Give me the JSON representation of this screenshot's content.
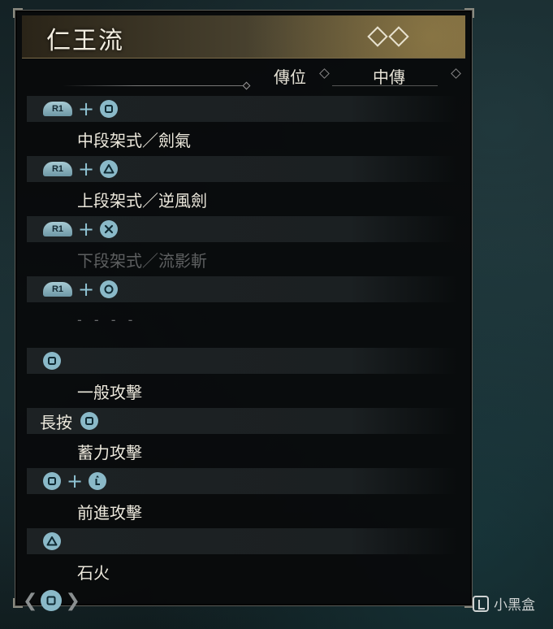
{
  "header": {
    "title": "仁王流"
  },
  "rank": {
    "label": "傳位",
    "value": "中傳"
  },
  "combos": [
    {
      "trigger": "R1",
      "plus": "+",
      "face": "square",
      "action": "中段架式／劍氣",
      "state": "normal"
    },
    {
      "trigger": "R1",
      "plus": "+",
      "face": "triangle",
      "action": "上段架式／逆風劍",
      "state": "normal"
    },
    {
      "trigger": "R1",
      "plus": "+",
      "face": "cross",
      "action": "下段架式／流影斬",
      "state": "disabled"
    },
    {
      "trigger": "R1",
      "plus": "+",
      "face": "circle",
      "action": "- - - -",
      "state": "placeholder"
    }
  ],
  "basics": [
    {
      "prefix": "",
      "face": "square",
      "action": "一般攻擊"
    },
    {
      "prefix": "長按",
      "face": "square",
      "action": "蓄力攻擊"
    },
    {
      "prefix": "",
      "face": "square",
      "extra": "left-stick",
      "plus": "+",
      "action": "前進攻擊"
    },
    {
      "prefix": "",
      "face": "triangle",
      "action": "石火"
    }
  ],
  "footer": {
    "button": "square"
  },
  "watermark": {
    "text": "小黑盒"
  },
  "colors": {
    "accent": "#8ab9c8",
    "text": "#ece8dc",
    "disabled": "#5d5f60"
  }
}
